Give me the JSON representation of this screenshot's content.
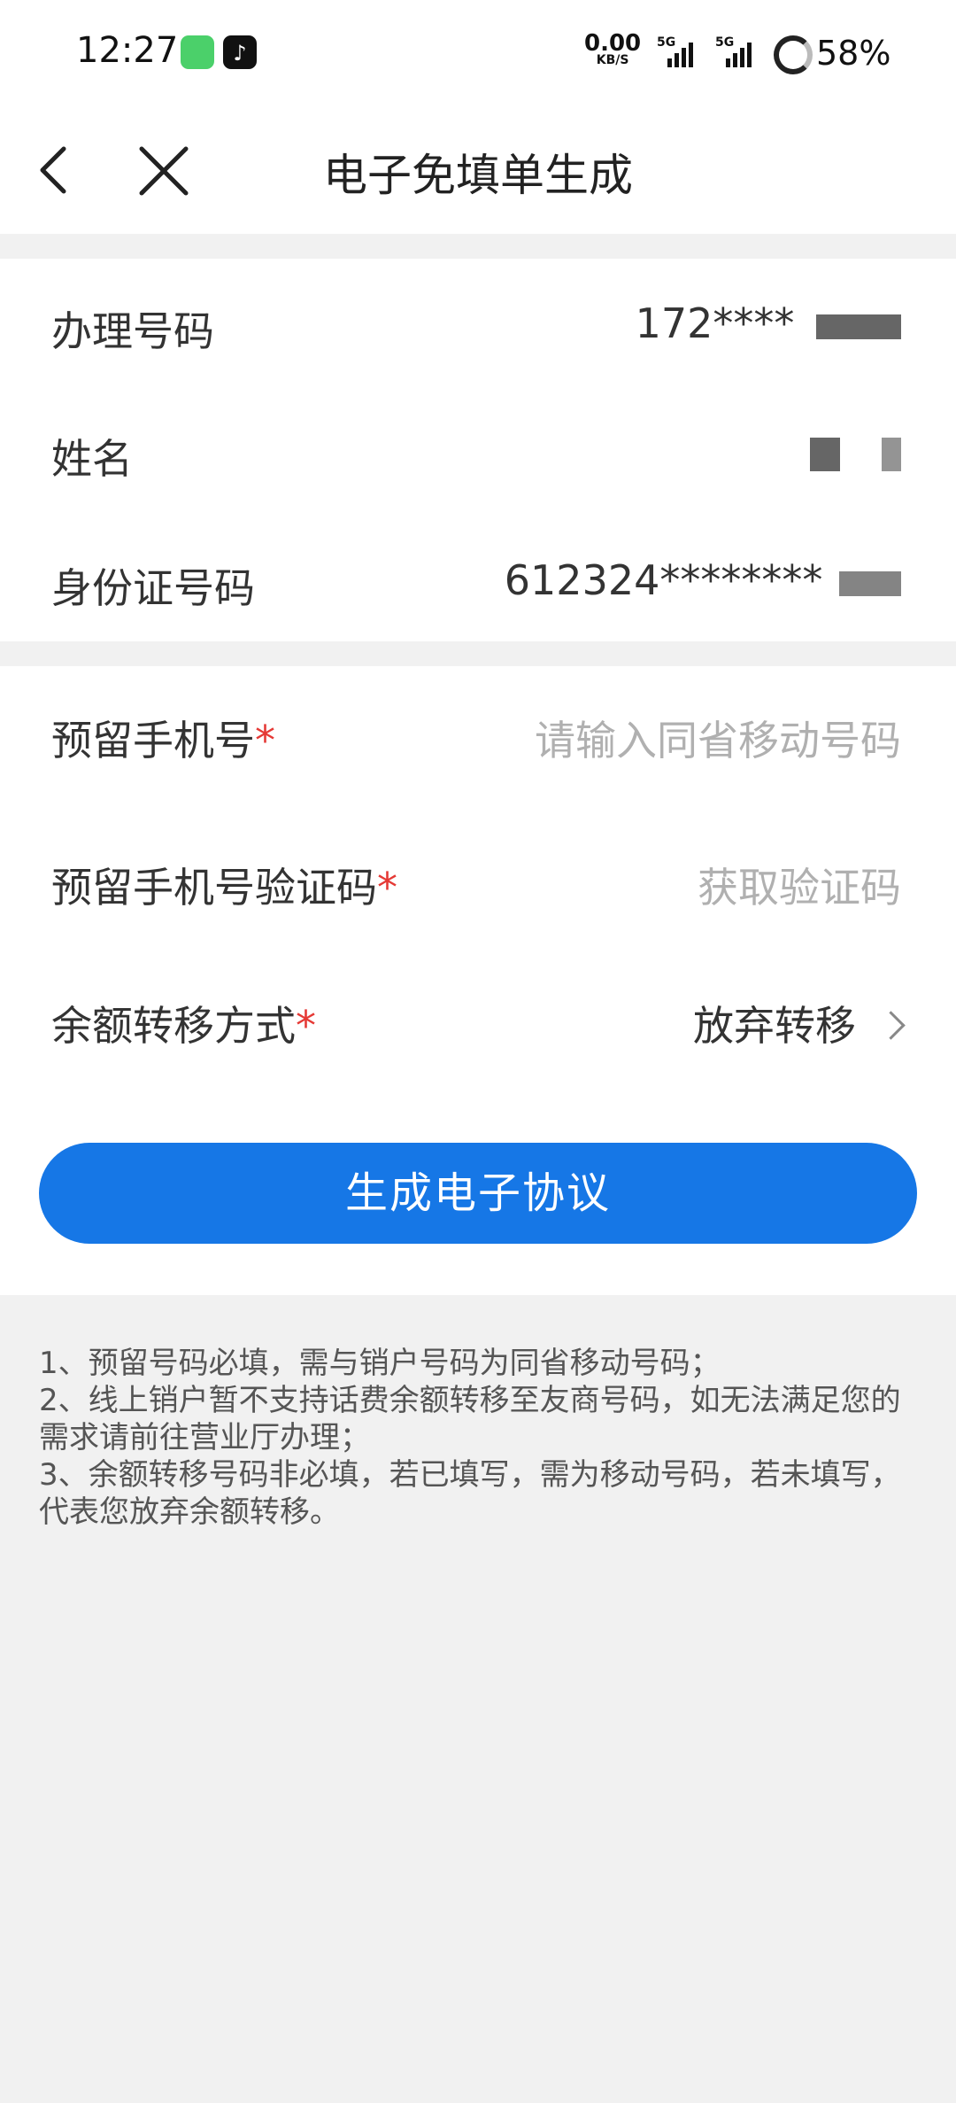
{
  "status_bar": {
    "time": "12:27",
    "net_speed": "0.00",
    "net_unit": "KB/S",
    "signal1": "5G",
    "signal2": "5G",
    "battery": "58%"
  },
  "nav": {
    "title": "电子免填单生成"
  },
  "info": {
    "phone_label": "办理号码",
    "phone_value": "172****",
    "name_label": "姓名",
    "id_label": "身份证号码",
    "id_value": "612324********"
  },
  "form": {
    "reserved_phone_label": "预留手机号",
    "reserved_phone_placeholder": "请输入同省移动号码",
    "verify_label": "预留手机号验证码",
    "verify_action": "获取验证码",
    "transfer_label": "余额转移方式",
    "transfer_value": "放弃转移",
    "required_mark": "*"
  },
  "button": {
    "label": "生成电子协议"
  },
  "notes": [
    "1、预留号码必填，需与销户号码为同省移动号码；",
    "2、线上销户暂不支持话费余额转移至友商号码，如无法满足您的需求请前往营业厅办理；",
    "3、余额转移号码非必填，若已填写，需为移动号码，若未填写，代表您放弃余额转移。"
  ],
  "colors": {
    "primary": "#1677e6",
    "required": "#e53935",
    "background": "#f1f1f1"
  }
}
